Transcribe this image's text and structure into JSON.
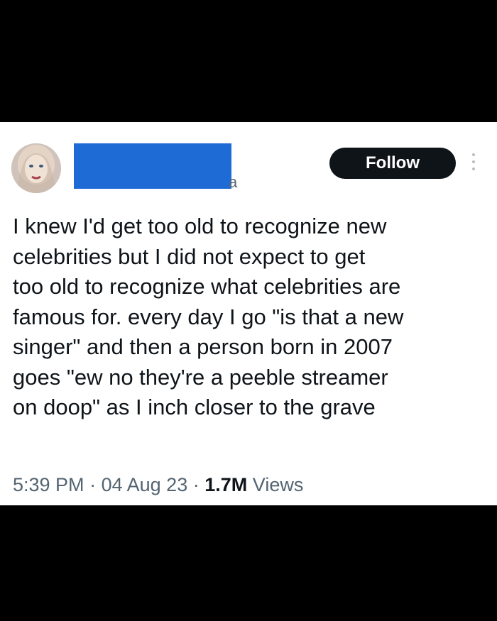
{
  "post": {
    "author": {
      "handle_visible_fragment": "a"
    },
    "follow_label": "Follow",
    "text_lines": [
      "I knew I'd get too old to recognize new",
      "celebrities but I did not expect to get",
      "too old to recognize what celebrities are",
      "famous for. every day I go \"is that a new",
      "singer\" and then a person born in 2007",
      "goes \"ew no they're a peeble streamer",
      "on doop\" as I inch closer to the grave"
    ],
    "meta": {
      "time": "5:39 PM",
      "separator": "·",
      "date": "04 Aug 23",
      "views_count": "1.7M",
      "views_label": "Views"
    }
  },
  "colors": {
    "redaction": "#1f6bd6",
    "follow_bg": "#0f1419",
    "meta_text": "#536471"
  }
}
